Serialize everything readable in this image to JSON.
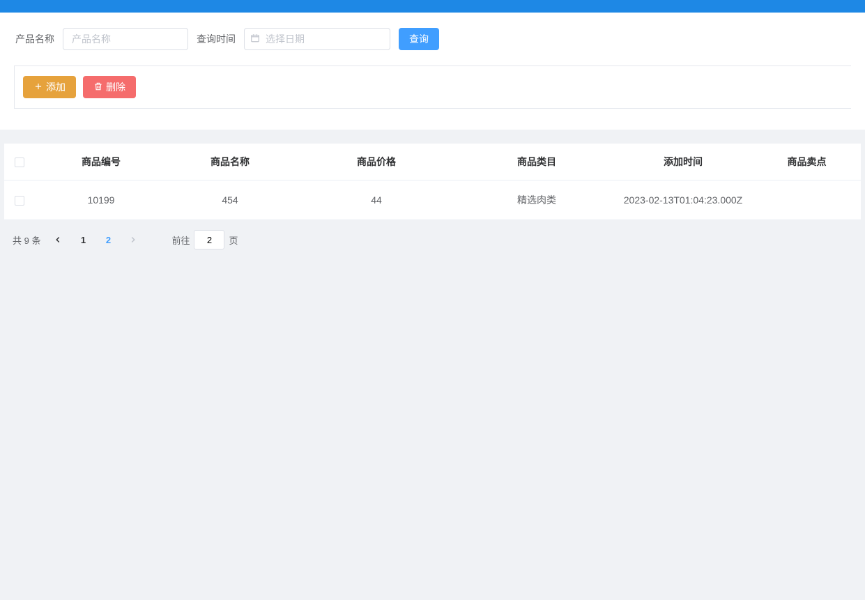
{
  "filter": {
    "product_name_label": "产品名称",
    "product_name_placeholder": "产品名称",
    "query_time_label": "查询时间",
    "date_placeholder": "选择日期",
    "search_label": "查询"
  },
  "toolbar": {
    "add_label": "添加",
    "delete_label": "删除"
  },
  "table": {
    "headers": {
      "id": "商品编号",
      "name": "商品名称",
      "price": "商品价格",
      "category": "商品类目",
      "add_time": "添加时间",
      "selling_point": "商品卖点"
    },
    "rows": [
      {
        "id": "10199",
        "name": "454",
        "price": "44",
        "category": "精选肉类",
        "add_time": "2023-02-13T01:04:23.000Z",
        "selling_point": ""
      }
    ]
  },
  "pagination": {
    "total_text": "共 9 条",
    "pages": [
      "1",
      "2"
    ],
    "current_page": "2",
    "jumper_prefix": "前往",
    "jumper_suffix": "页",
    "jumper_value": "2"
  }
}
